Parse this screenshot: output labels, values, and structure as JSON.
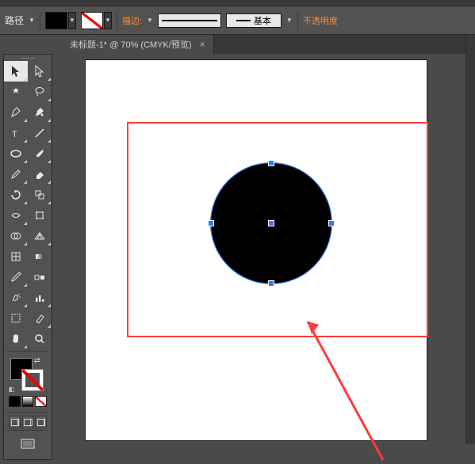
{
  "options": {
    "mode_label": "路径",
    "stroke_label": "描边:",
    "stroke_style_label": "基本",
    "opacity_label": "不透明度"
  },
  "document": {
    "tab_title": "未标题-1* @ 70% (CMYK/预览)"
  },
  "canvas": {
    "shape": "ellipse",
    "fill": "#000000",
    "selected": true
  }
}
